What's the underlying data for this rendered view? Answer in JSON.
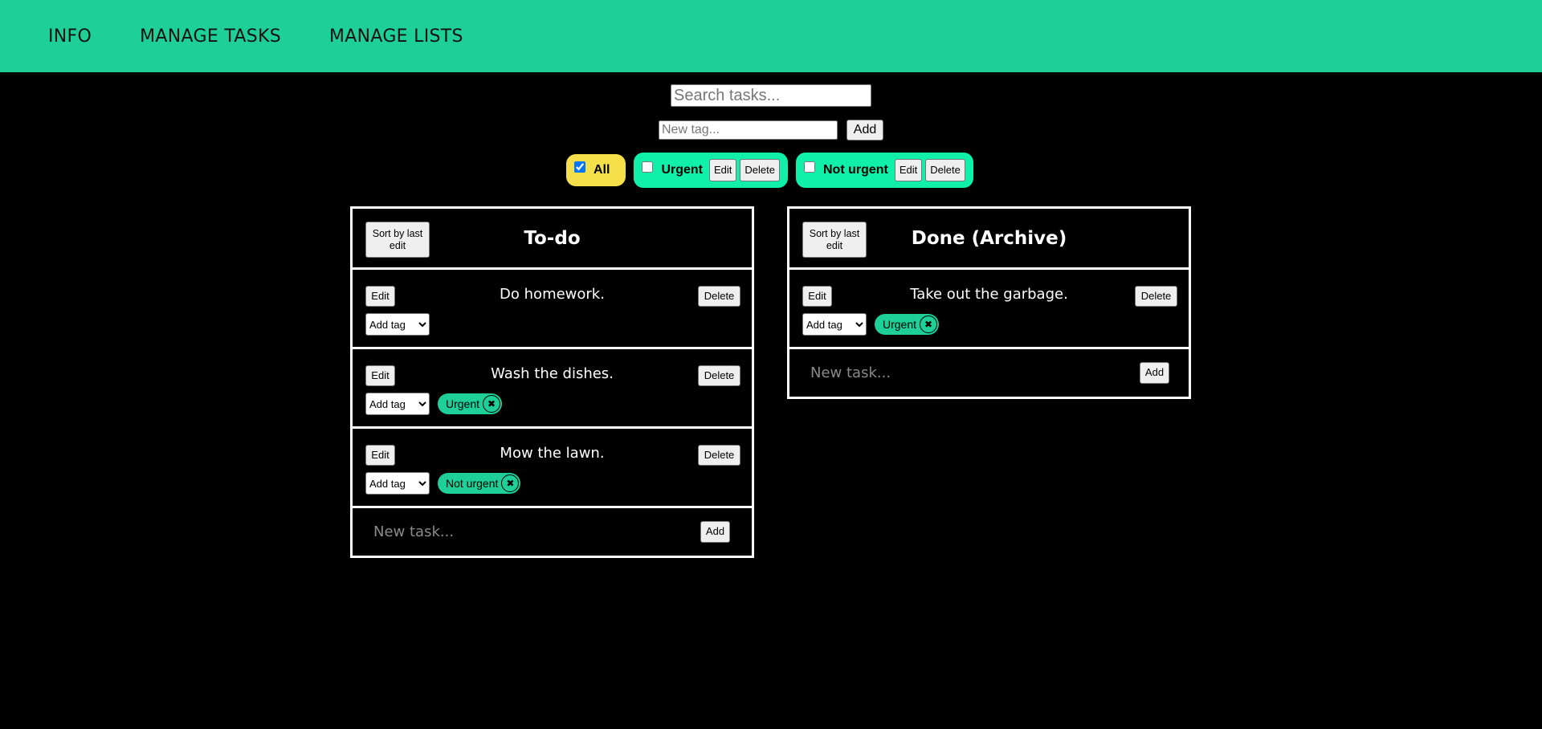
{
  "nav": {
    "items": [
      {
        "label": "INFO"
      },
      {
        "label": "MANAGE TASKS"
      },
      {
        "label": "MANAGE LISTS"
      }
    ]
  },
  "search": {
    "placeholder": "Search tasks..."
  },
  "newTag": {
    "placeholder": "New tag...",
    "add_label": "Add"
  },
  "filters": {
    "all": {
      "label": "All",
      "checked": true,
      "color": "#f5e04b"
    },
    "tags": [
      {
        "label": "Urgent",
        "edit_label": "Edit",
        "delete_label": "Delete",
        "color": "#10f0a8"
      },
      {
        "label": "Not urgent",
        "edit_label": "Edit",
        "delete_label": "Delete",
        "color": "#10f0a8"
      }
    ]
  },
  "lists": [
    {
      "title": "To-do",
      "sort_label": "Sort by last edit",
      "tasks": [
        {
          "text": "Do homework.",
          "edit_label": "Edit",
          "delete_label": "Delete",
          "tag_select": "Add tag",
          "tags": []
        },
        {
          "text": "Wash the dishes.",
          "edit_label": "Edit",
          "delete_label": "Delete",
          "tag_select": "Add tag",
          "tags": [
            "Urgent"
          ]
        },
        {
          "text": "Mow the lawn.",
          "edit_label": "Edit",
          "delete_label": "Delete",
          "tag_select": "Add tag",
          "tags": [
            "Not urgent"
          ]
        }
      ],
      "new_task_placeholder": "New task...",
      "add_label": "Add"
    },
    {
      "title": "Done (Archive)",
      "sort_label": "Sort by last edit",
      "tasks": [
        {
          "text": "Take out the garbage.",
          "edit_label": "Edit",
          "delete_label": "Delete",
          "tag_select": "Add tag",
          "tags": [
            "Urgent"
          ]
        }
      ],
      "new_task_placeholder": "New task...",
      "add_label": "Add"
    }
  ],
  "colors": {
    "navbar": "#1ecf98",
    "tag_pill": "#1ecf98",
    "background": "#000000"
  },
  "icons": {
    "tag_remove": "close-icon"
  }
}
